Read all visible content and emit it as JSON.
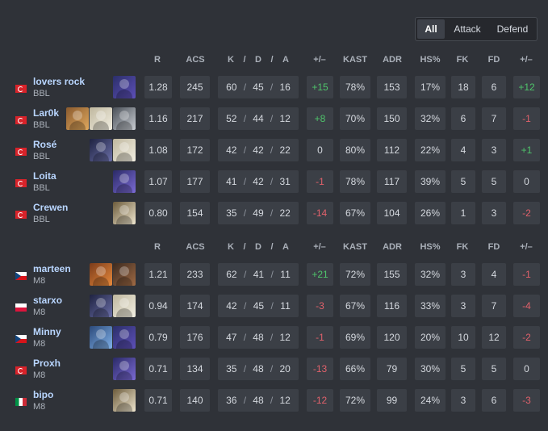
{
  "tabs": [
    "All",
    "Attack",
    "Defend"
  ],
  "active_tab": "All",
  "columns": [
    "R",
    "ACS",
    "K",
    "/",
    "D",
    "/",
    "A",
    "+/–",
    "KAST",
    "ADR",
    "HS%",
    "FK",
    "FD",
    "+/–"
  ],
  "teams": [
    {
      "players": [
        {
          "name": "lovers rock",
          "team": "BBL",
          "flag": "tr",
          "agents": [
            "purple"
          ],
          "r": "1.28",
          "acs": "245",
          "k": "60",
          "d": "45",
          "a": "16",
          "pm": "+15",
          "kast": "78%",
          "adr": "153",
          "hs": "17%",
          "fk": "18",
          "fd": "6",
          "fpm": "+12"
        },
        {
          "name": "Lar0k",
          "team": "BBL",
          "flag": "tr",
          "agents": [
            "gold",
            "light",
            "steel"
          ],
          "r": "1.16",
          "acs": "217",
          "k": "52",
          "d": "44",
          "a": "12",
          "pm": "+8",
          "kast": "70%",
          "adr": "150",
          "hs": "32%",
          "fk": "6",
          "fd": "7",
          "fpm": "-1"
        },
        {
          "name": "Rosé",
          "team": "BBL",
          "flag": "tr",
          "agents": [
            "dark",
            "light"
          ],
          "r": "1.08",
          "acs": "172",
          "k": "42",
          "d": "42",
          "a": "22",
          "pm": "0",
          "kast": "80%",
          "adr": "112",
          "hs": "22%",
          "fk": "4",
          "fd": "3",
          "fpm": "+1"
        },
        {
          "name": "Loita",
          "team": "BBL",
          "flag": "tr",
          "agents": [
            "violet"
          ],
          "r": "1.07",
          "acs": "177",
          "k": "41",
          "d": "42",
          "a": "31",
          "pm": "-1",
          "kast": "78%",
          "adr": "117",
          "hs": "39%",
          "fk": "5",
          "fd": "5",
          "fpm": "0"
        },
        {
          "name": "Crewen",
          "team": "BBL",
          "flag": "tr",
          "agents": [
            "cream"
          ],
          "r": "0.80",
          "acs": "154",
          "k": "35",
          "d": "49",
          "a": "22",
          "pm": "-14",
          "kast": "67%",
          "adr": "104",
          "hs": "26%",
          "fk": "1",
          "fd": "3",
          "fpm": "-2"
        }
      ]
    },
    {
      "players": [
        {
          "name": "marteen",
          "team": "M8",
          "flag": "cz",
          "agents": [
            "orange",
            "brown"
          ],
          "r": "1.21",
          "acs": "233",
          "k": "62",
          "d": "41",
          "a": "11",
          "pm": "+21",
          "kast": "72%",
          "adr": "155",
          "hs": "32%",
          "fk": "3",
          "fd": "4",
          "fpm": "-1"
        },
        {
          "name": "starxo",
          "team": "M8",
          "flag": "pl",
          "agents": [
            "dark",
            "light"
          ],
          "r": "0.94",
          "acs": "174",
          "k": "42",
          "d": "45",
          "a": "11",
          "pm": "-3",
          "kast": "67%",
          "adr": "116",
          "hs": "33%",
          "fk": "3",
          "fd": "7",
          "fpm": "-4"
        },
        {
          "name": "Minny",
          "team": "M8",
          "flag": "cz",
          "agents": [
            "blue",
            "purple"
          ],
          "r": "0.79",
          "acs": "176",
          "k": "47",
          "d": "48",
          "a": "12",
          "pm": "-1",
          "kast": "69%",
          "adr": "120",
          "hs": "20%",
          "fk": "10",
          "fd": "12",
          "fpm": "-2"
        },
        {
          "name": "Proxh",
          "team": "M8",
          "flag": "tr",
          "agents": [
            "violet"
          ],
          "r": "0.71",
          "acs": "134",
          "k": "35",
          "d": "48",
          "a": "20",
          "pm": "-13",
          "kast": "66%",
          "adr": "79",
          "hs": "30%",
          "fk": "5",
          "fd": "5",
          "fpm": "0"
        },
        {
          "name": "bipo",
          "team": "M8",
          "flag": "it",
          "agents": [
            "cream"
          ],
          "r": "0.71",
          "acs": "140",
          "k": "36",
          "d": "48",
          "a": "12",
          "pm": "-12",
          "kast": "72%",
          "adr": "99",
          "hs": "24%",
          "fk": "3",
          "fd": "6",
          "fpm": "-3"
        }
      ]
    }
  ]
}
